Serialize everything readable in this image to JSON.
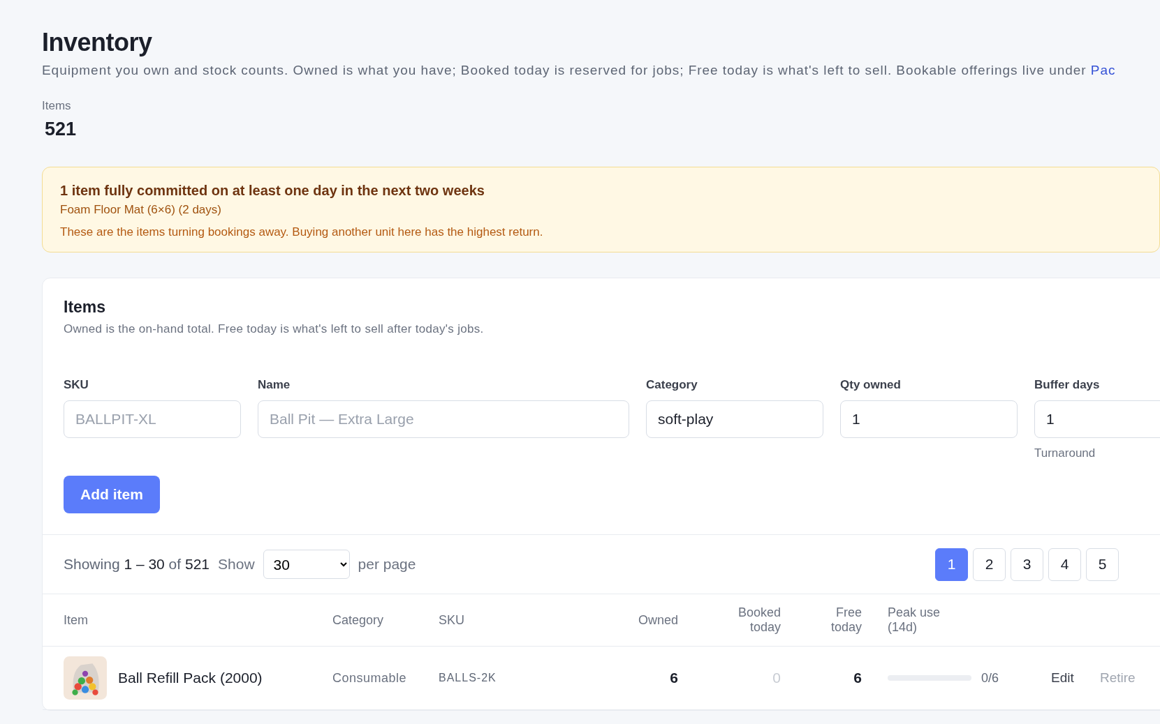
{
  "page": {
    "title": "Inventory",
    "subtitle": "Equipment you own and stock counts. Owned is what you have; Booked today is reserved for jobs; Free today is what's left to sell. Bookable offerings live under",
    "subtitle_link": "Pac"
  },
  "stats": [
    {
      "label": "Items",
      "value": "521"
    }
  ],
  "alert": {
    "title": "1 item fully committed on at least one day in the next two weeks",
    "items": [
      "Foam Floor Mat (6×6) (2 days)"
    ],
    "note": "These are the items turning bookings away. Buying another unit here has the highest return."
  },
  "card": {
    "title": "Items",
    "subtitle": "Owned is the on-hand total. Free today is what's left to sell after today's jobs."
  },
  "form": {
    "fields": [
      {
        "label": "SKU",
        "placeholder": "BALLPIT-XL"
      },
      {
        "label": "Name",
        "placeholder": "Ball Pit — Extra Large"
      },
      {
        "label": "Category",
        "value": "soft-play"
      },
      {
        "label": "Qty owned",
        "value": "1"
      },
      {
        "label": "Buffer days",
        "value": "1",
        "hint": "Turnaround"
      }
    ],
    "submit": "Add item"
  },
  "pagination": {
    "showing": "Showing **1 – 30** of **521**",
    "show_label": "Show",
    "per_page": "30",
    "per_page_label": "per page",
    "pages": [
      {
        "label": "1",
        "selected": true
      },
      {
        "label": "2",
        "selected": false
      },
      {
        "label": "3",
        "selected": false
      },
      {
        "label": "4",
        "selected": false
      },
      {
        "label": "5",
        "selected": false
      }
    ]
  },
  "table": {
    "columns": [
      "Item",
      "Category",
      "SKU",
      "Owned",
      "Booked today",
      "Free today",
      "Peak use (14d)"
    ],
    "rows": [
      {
        "item": "Ball Refill Pack (2000)",
        "category": "Consumable",
        "sku": "BALLS-2K",
        "owned": "6",
        "booked_today": "0",
        "free_today": "6",
        "peak_use": {
          "level": 0,
          "reading": "0/6"
        },
        "actions": [
          "Edit",
          "Retire"
        ]
      }
    ]
  }
}
